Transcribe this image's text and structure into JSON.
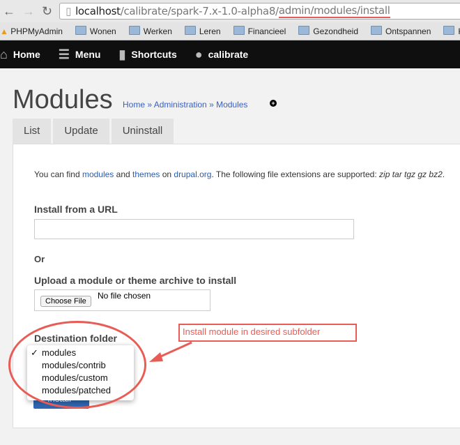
{
  "browser": {
    "url_host": "localhost",
    "url_path": "/calibrate/spark-7.x-1.0-alpha8/",
    "url_highlight": "admin/modules/install",
    "bookmarks": [
      "PHPMyAdmin",
      "Wonen",
      "Werken",
      "Leren",
      "Financieel",
      "Gezondheid",
      "Ontspannen",
      "Ko"
    ]
  },
  "toolbar": {
    "home": "Home",
    "menu": "Menu",
    "shortcuts": "Shortcuts",
    "user": "calibrate"
  },
  "page": {
    "title": "Modules",
    "breadcrumb": [
      "Home",
      "Administration",
      "Modules"
    ],
    "sep": " » ",
    "tabs": [
      "List",
      "Update",
      "Uninstall"
    ],
    "intro": {
      "a": "You can find ",
      "modules": "modules",
      "b": " and ",
      "themes": "themes",
      "c": " on ",
      "drupal": "drupal.org",
      "d": ". The following file extensions are supported: ",
      "ext": "zip tar tgz gz bz2",
      "e": "."
    },
    "url_label": "Install from a URL",
    "or": "Or",
    "upload_label": "Upload a module or theme archive to install",
    "choose_file": "Choose File",
    "no_file": "No file chosen",
    "dest_label": "Destination folder",
    "dest_options": [
      "modules",
      "modules/contrib",
      "modules/custom",
      "modules/patched"
    ],
    "dest_selected": "modules",
    "install": "Install"
  },
  "annotation": {
    "note": "Install module in desired subfolder",
    "color": "#e95c56"
  }
}
